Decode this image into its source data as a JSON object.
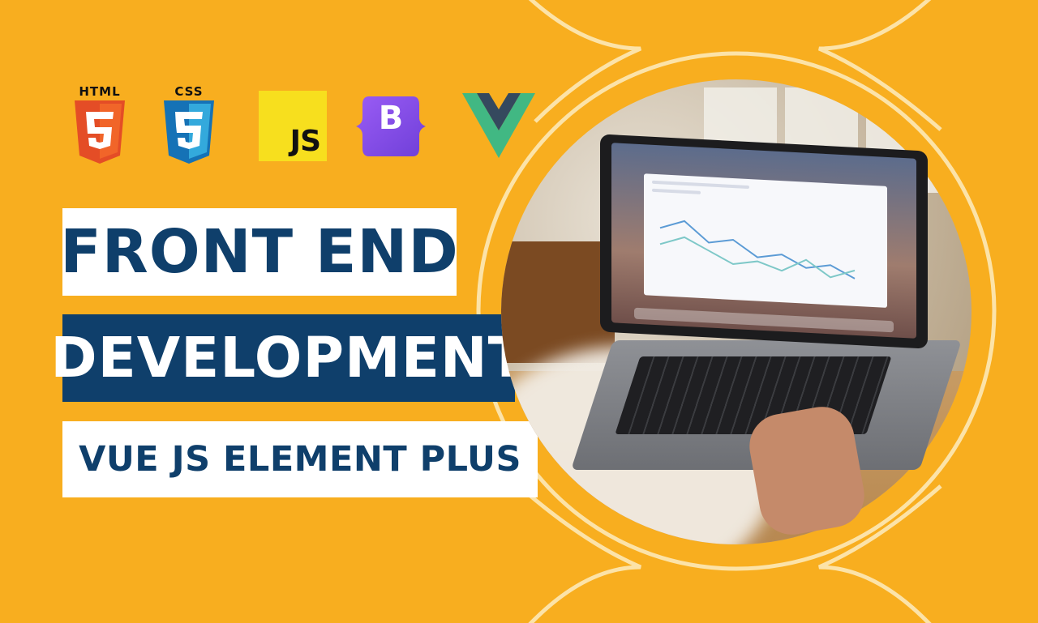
{
  "logos": {
    "html": {
      "label": "HTML",
      "digit": "5",
      "color": "#E44D26",
      "color_light": "#F16529"
    },
    "css": {
      "label": "CSS",
      "digit": "3",
      "color": "#1572B6",
      "color_light": "#33A9DC"
    },
    "js": {
      "label": "JS",
      "color": "#F7DF1E"
    },
    "bootstrap": {
      "label": "B",
      "color": "#7952B3",
      "color_light": "#8F5BF0"
    },
    "vue": {
      "color_outer": "#41B883",
      "color_inner": "#35495E"
    }
  },
  "title": {
    "line1": "FRONT END",
    "line2": "DEVELOPMENT",
    "line3": "VUE JS ELEMENT PLUS"
  },
  "colors": {
    "background": "#F8AE1F",
    "navy": "#0F3F6B",
    "white": "#FFFFFF",
    "line": "#FCE3A8"
  },
  "photo": {
    "icon": "laptop-photo"
  }
}
